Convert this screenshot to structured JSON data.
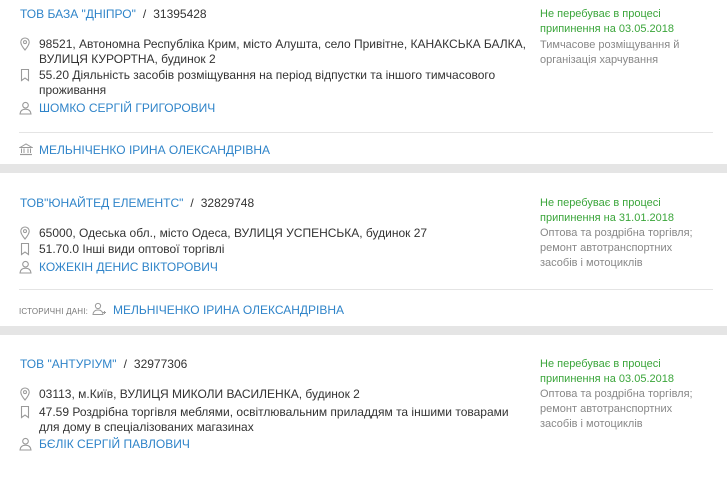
{
  "colors": {
    "link": "#2f84c9",
    "status_green": "#3aa53a",
    "muted": "#888888",
    "separator": "#e5e5e5"
  },
  "cards": [
    {
      "name": "ТОВ БАЗА \"ДНІПРО\"",
      "code": "31395428",
      "address_line1": "98521, Автономна Республіка Крим, місто Алушта, село Привітне, КАНАКСЬКА БАЛКА,",
      "address_line2": "ВУЛИЦЯ КУРОРТНА, будинок 2",
      "kved_line1": "55.20 Діяльність засобів розміщування на період відпустки та іншого тимчасового",
      "kved_line2": "проживання",
      "director": "ШОМКО СЕРГІЙ ГРИГОРОВИЧ",
      "founder": "МЕЛЬНІЧЕНКО ІРИНА ОЛЕКСАНДРІВНА",
      "status_line1": "Не перебуває в процесі",
      "status_line2": "припинення на 03.05.2018",
      "activity_line1": "Тимчасове розміщування й",
      "activity_line2": "організація харчування"
    },
    {
      "name": "ТОВ\"ЮНАЙТЕД ЕЛЕМЕНТС\"",
      "code": "32829748",
      "address_line1": "65000, Одеська обл., місто Одеса, ВУЛИЦЯ УСПЕНСЬКА, будинок 27",
      "kved_line1": "51.70.0 Інші види оптової торгівлі",
      "director": "КОЖЕКІН ДЕНИС ВІКТОРОВИЧ",
      "history_label": "ІСТОРИЧНІ ДАНІ:",
      "history_person": "МЕЛЬНІЧЕНКО ІРИНА ОЛЕКСАНДРІВНА",
      "status_line1": "Не перебуває в процесі",
      "status_line2": "припинення на 31.01.2018",
      "activity_line1": "Оптова та роздрібна торгівля;",
      "activity_line2": "ремонт автотранспортних",
      "activity_line3": "засобів і мотоциклів"
    },
    {
      "name": "ТОВ \"АНТУРІУМ\"",
      "code": "32977306",
      "address_line1": "03113, м.Київ, ВУЛИЦЯ МИКОЛИ ВАСИЛЕНКА, будинок 2",
      "kved_line1": "47.59 Роздрібна торгівля меблями, освітлювальним приладдям та іншими товарами",
      "kved_line2": "для дому в спеціалізованих магазинах",
      "director": "БЄЛІК СЕРГІЙ ПАВЛОВИЧ",
      "status_line1": "Не перебуває в процесі",
      "status_line2": "припинення на 03.05.2018",
      "activity_line1": "Оптова та роздрібна торгівля;",
      "activity_line2": "ремонт автотранспортних",
      "activity_line3": "засобів і мотоциклів"
    }
  ]
}
